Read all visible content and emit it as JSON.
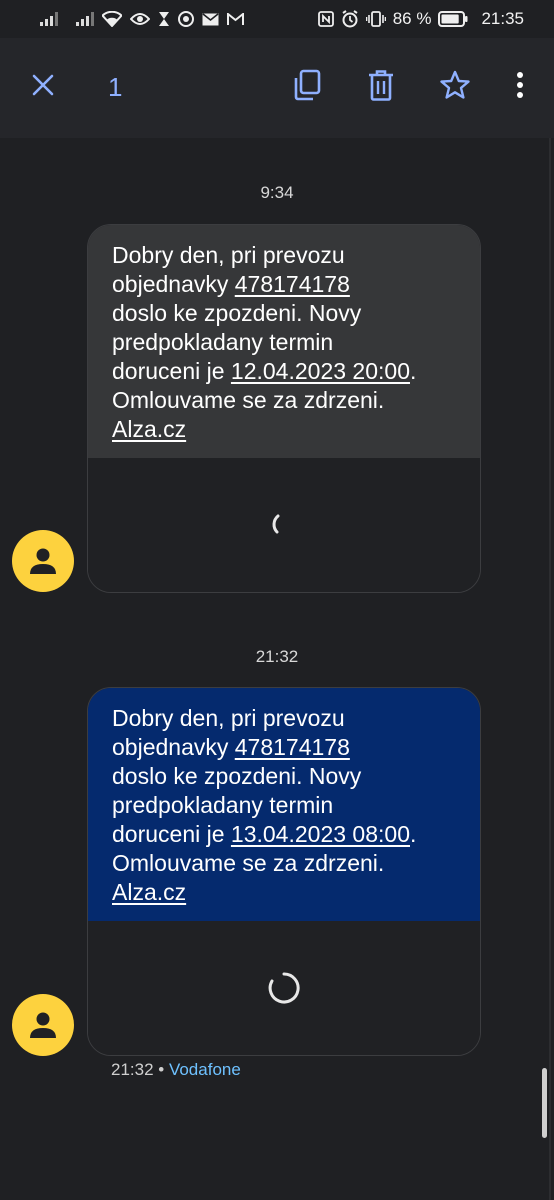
{
  "status_bar": {
    "battery_percent": "86 %",
    "time": "21:35",
    "battery_level": 0.86
  },
  "app_bar": {
    "selected_count": "1",
    "icons": [
      "close-icon",
      "copy-icon",
      "delete-icon",
      "star-icon",
      "more-vert-icon"
    ]
  },
  "messages": [
    {
      "timestamp": "9:34",
      "style": "received",
      "text": {
        "line1": "Dobry den, pri prevozu",
        "line2_pre": "objednavky ",
        "order_number": "478174178",
        "line3": "doslo ke zpozdeni. Novy",
        "line4": "predpokladany termin",
        "line5_pre": "doruceni je ",
        "date": "12.04.2023 20:00",
        "line5_post": ".",
        "line6": "Omlouvame se za zdrzeni.",
        "link": "Alza.cz"
      }
    },
    {
      "timestamp": "21:32",
      "style": "selected",
      "text": {
        "line1": "Dobry den, pri prevozu",
        "line2_pre": "objednavky ",
        "order_number": "478174178",
        "line3": "doslo ke zpozdeni. Novy",
        "line4": "predpokladany termin",
        "line5_pre": "doruceni je ",
        "date": "13.04.2023 08:00",
        "line5_post": ".",
        "line6": "Omlouvame se za zdrzeni.",
        "link": "Alza.cz"
      },
      "meta_time": "21:32",
      "meta_separator": " • ",
      "meta_carrier": "Vodafone"
    }
  ],
  "colors": {
    "accent": "#8fb0ff",
    "avatar": "#fdd23e",
    "selected_bubble": "#052a6e",
    "received_bubble": "#363739",
    "carrier": "#6ec1ff"
  }
}
